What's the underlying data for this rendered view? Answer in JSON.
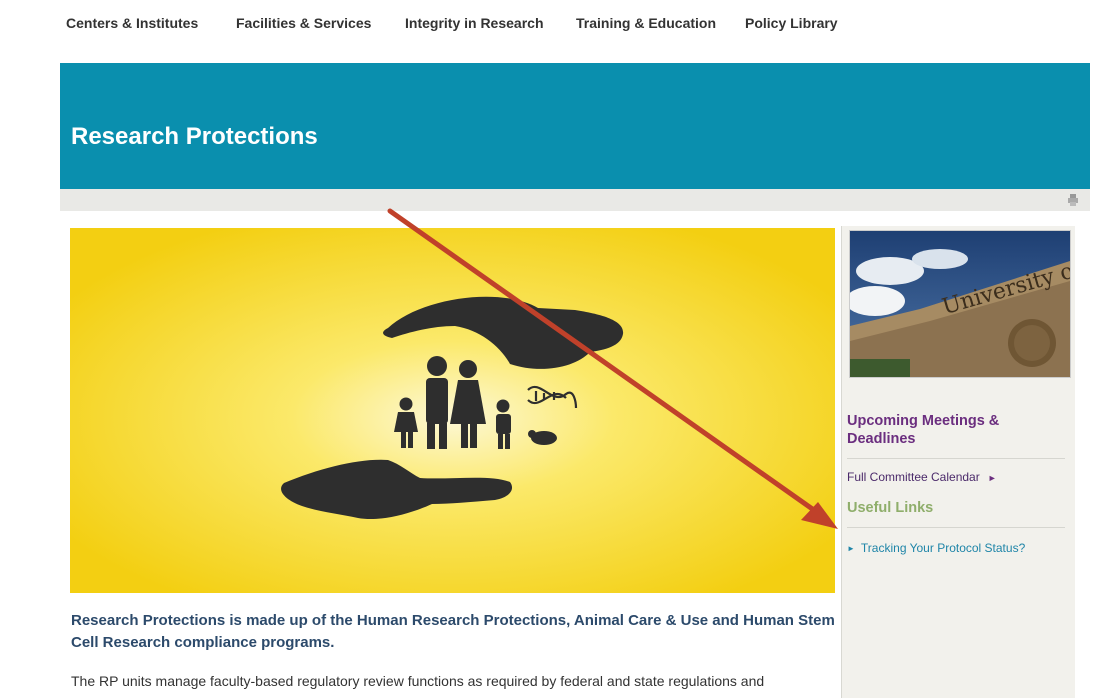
{
  "nav": {
    "items": [
      "Centers & Institutes",
      "Facilities & Services",
      "Integrity in Research",
      "Training & Education",
      "Policy Library"
    ]
  },
  "banner": {
    "title": "Research Protections"
  },
  "main": {
    "lead": "Research Protections is made up of the Human Research Protections, Animal Care & Use and Human Stem Cell Research compliance programs.",
    "body": "The RP units manage faculty-based regulatory review functions as required by federal and state regulations and"
  },
  "sidebar": {
    "photo_text": "University of California, Irvine",
    "meetings_heading": "Upcoming Meetings & Deadlines",
    "calendar_link": "Full Committee Calendar",
    "useful_heading": "Useful Links",
    "tracking_link": "Tracking Your Protocol Status?"
  },
  "colors": {
    "banner": "#0a8fae",
    "hero": "#f5d41a",
    "heading": "#6b2e7f",
    "useful": "#8fae6b",
    "arrow": "#c0412a",
    "link": "#1f85a8"
  },
  "icons": {
    "print": "print-icon",
    "chevron": "triangle-right-icon",
    "bullet": "triangle-right-icon"
  }
}
